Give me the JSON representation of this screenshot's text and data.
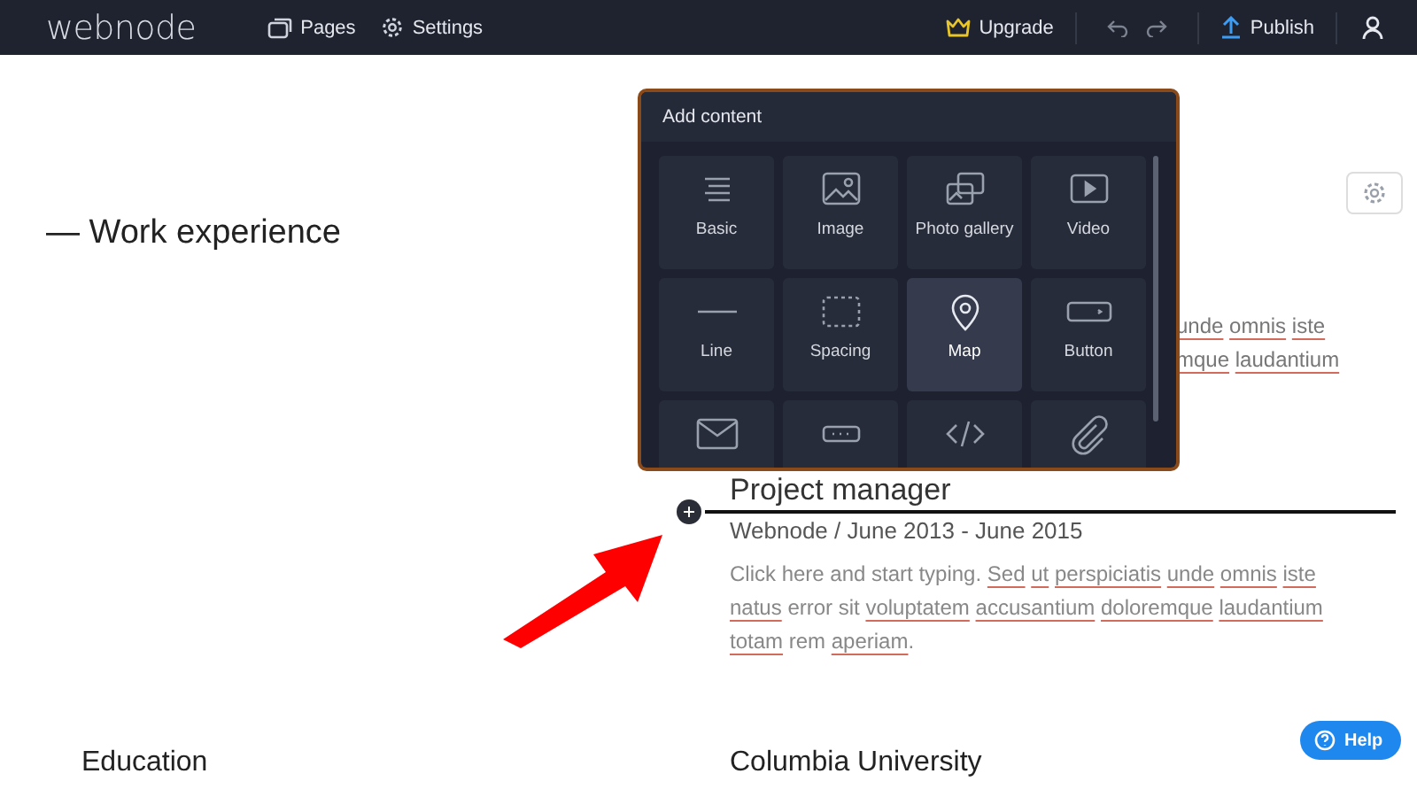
{
  "topbar": {
    "logo": "webnode",
    "nav": [
      {
        "label": "Pages"
      },
      {
        "label": "Settings"
      }
    ],
    "upgrade": "Upgrade",
    "publish": "Publish"
  },
  "section_heading": "— Work experience",
  "hidden_lines": [
    [
      {
        "text": "unde",
        "flagged": true
      },
      {
        "text": "omnis",
        "flagged": true
      },
      {
        "text": "iste",
        "flagged": true
      }
    ],
    [
      {
        "text": "mque",
        "flagged": true
      },
      {
        "text": "laudantium",
        "flagged": true
      }
    ]
  ],
  "job": {
    "title": "Project manager",
    "subtitle": "Webnode / June 2013 - June 2015",
    "paragraph": [
      {
        "text": "Click here and start typing.",
        "flagged": false
      },
      {
        "text": "Sed",
        "flagged": true
      },
      {
        "text": "ut",
        "flagged": true
      },
      {
        "text": "perspiciatis",
        "flagged": true
      },
      {
        "text": "unde",
        "flagged": true
      },
      {
        "text": "omnis",
        "flagged": true
      },
      {
        "text": "iste",
        "flagged": true
      },
      {
        "text": "natus",
        "flagged": true
      },
      {
        "text": "error sit",
        "flagged": false
      },
      {
        "text": "voluptatem",
        "flagged": true
      },
      {
        "text": "accusantium",
        "flagged": true
      },
      {
        "text": "doloremque",
        "flagged": true
      },
      {
        "text": "laudantium",
        "flagged": true
      },
      {
        "text": "totam",
        "flagged": true
      },
      {
        "text": "rem",
        "flagged": false
      },
      {
        "text": "aperiam",
        "flagged": true
      },
      {
        "text": ".",
        "flagged": false
      }
    ]
  },
  "add_content": {
    "title": "Add content",
    "items": [
      {
        "label": "Basic",
        "kind": "text",
        "selected": false
      },
      {
        "label": "Image",
        "kind": "image",
        "selected": false
      },
      {
        "label": "Photo gallery",
        "kind": "gallery",
        "selected": false
      },
      {
        "label": "Video",
        "kind": "video",
        "selected": false
      },
      {
        "label": "Line",
        "kind": "line",
        "selected": false
      },
      {
        "label": "Spacing",
        "kind": "spacing",
        "selected": false
      },
      {
        "label": "Map",
        "kind": "map",
        "selected": true
      },
      {
        "label": "Button",
        "kind": "button",
        "selected": false
      },
      {
        "kind": "envelope",
        "selected": false
      },
      {
        "kind": "field",
        "selected": false
      },
      {
        "kind": "code",
        "selected": false
      },
      {
        "kind": "clip",
        "selected": false
      }
    ]
  },
  "bottom": {
    "left_heading": "Education",
    "right_heading": "Columbia University"
  },
  "help": "Help"
}
